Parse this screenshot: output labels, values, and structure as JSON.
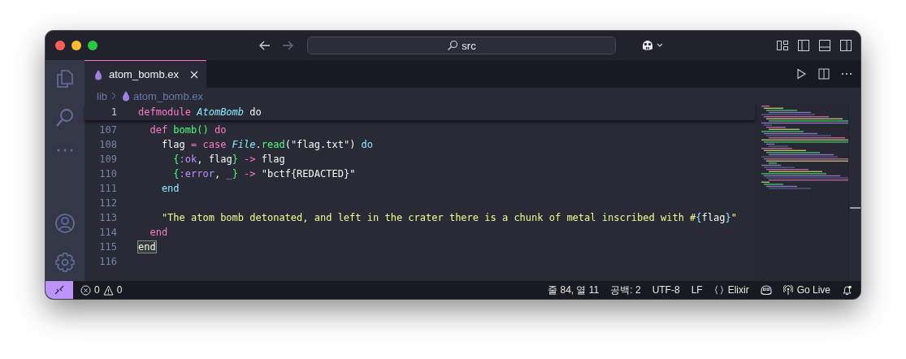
{
  "command_center": {
    "label": "src"
  },
  "tabs": [
    {
      "label": "atom_bomb.ex",
      "selected": true
    }
  ],
  "breadcrumb": [
    "lib",
    "atom_bomb.ex"
  ],
  "sticky_line": {
    "number": "1",
    "tokens": [
      {
        "kind": "kw",
        "text": "defmodule "
      },
      {
        "kind": "mod",
        "text": "AtomBomb"
      },
      {
        "kind": "txt",
        "text": " do"
      }
    ]
  },
  "lines": [
    {
      "number": "107",
      "tokens": [
        {
          "kind": "kw",
          "text": "  def "
        },
        {
          "kind": "fn",
          "text": "bomb() "
        },
        {
          "kind": "kw",
          "text": "do"
        }
      ]
    },
    {
      "number": "108",
      "tokens": [
        {
          "kind": "txt",
          "text": "    flag "
        },
        {
          "kind": "kw",
          "text": "= case "
        },
        {
          "kind": "mod",
          "text": "File"
        },
        {
          "kind": "txt",
          "text": "."
        },
        {
          "kind": "fn",
          "text": "read"
        },
        {
          "kind": "txt",
          "text": "(\"flag.txt\") "
        },
        {
          "kind": "blk",
          "text": "do"
        }
      ]
    },
    {
      "number": "109",
      "tokens": [
        {
          "kind": "brk",
          "text": "      {"
        },
        {
          "kind": "atom",
          "text": ":ok"
        },
        {
          "kind": "txt",
          "text": ", flag"
        },
        {
          "kind": "brk",
          "text": "}"
        },
        {
          "kind": "kw",
          "text": " ->"
        },
        {
          "kind": "txt",
          "text": " flag"
        }
      ]
    },
    {
      "number": "110",
      "tokens": [
        {
          "kind": "brk",
          "text": "      {"
        },
        {
          "kind": "atom",
          "text": ":error"
        },
        {
          "kind": "txt",
          "text": ", "
        },
        {
          "kind": "atom",
          "text": "_"
        },
        {
          "kind": "brk",
          "text": "}"
        },
        {
          "kind": "kw",
          "text": " ->"
        },
        {
          "kind": "txt",
          "text": " \"bctf{REDACTED}\""
        }
      ]
    },
    {
      "number": "111",
      "tokens": [
        {
          "kind": "blk",
          "text": "    end"
        }
      ]
    },
    {
      "number": "112"
    },
    {
      "number": "113",
      "tokens": [
        {
          "kind": "str",
          "text": "    \"The atom bomb detonated, and left in the crater there is a chunk of metal inscribed with #"
        },
        {
          "kind": "blk",
          "text": "{"
        },
        {
          "kind": "txt",
          "text": "flag"
        },
        {
          "kind": "blk",
          "text": "}"
        },
        {
          "kind": "str",
          "text": "\""
        }
      ]
    },
    {
      "number": "114",
      "tokens": [
        {
          "kind": "kw",
          "text": "  end"
        }
      ]
    },
    {
      "number": "115",
      "tokens": [
        {
          "kind": "match",
          "text": "end"
        }
      ]
    },
    {
      "number": "116"
    }
  ],
  "status_bar": {
    "errors": "0",
    "warnings": "0",
    "items": [
      {
        "kind": "text",
        "text": "줄 84, 열 11"
      },
      {
        "kind": "text",
        "text": "공백: 2"
      },
      {
        "kind": "text",
        "text": "UTF-8"
      },
      {
        "kind": "text",
        "text": "LF"
      },
      {
        "kind": "language",
        "text": "Elixir"
      },
      {
        "kind": "copilot"
      },
      {
        "kind": "live",
        "text": "Go Live"
      },
      {
        "kind": "bell"
      }
    ]
  }
}
